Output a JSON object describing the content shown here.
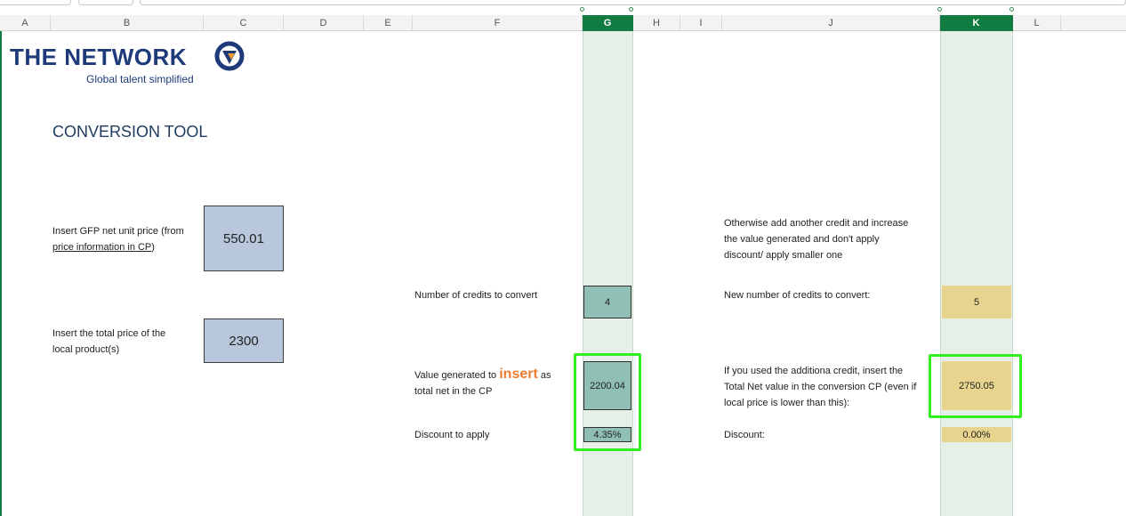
{
  "columns": [
    "A",
    "B",
    "C",
    "D",
    "E",
    "F",
    "G",
    "H",
    "I",
    "J",
    "K",
    "L"
  ],
  "selected_columns": [
    "G",
    "K"
  ],
  "logo": {
    "title": "THE NETWORK",
    "tagline": "Global talent simplified",
    "mark_icon": "network-globe-icon"
  },
  "title": "CONVERSION TOOL",
  "inputs": {
    "gfp_label_1": "Insert GFP net unit price (from",
    "gfp_label_2": "price information in CP",
    "gfp_label_3": ")",
    "gfp_value": "550.01",
    "local_label_1": "Insert the total price of the",
    "local_label_2": "local product(s)",
    "local_value": "2300"
  },
  "left_results": {
    "credits_label": "Number of credits to convert",
    "credits_value": "4",
    "value_label_1": "Value generated to",
    "value_label_insert": "insert",
    "value_label_2": "as",
    "value_label_3": "total net in the CP",
    "value_value": "2200.04",
    "discount_label": "Discount to apply",
    "discount_value": "4.35%"
  },
  "right_results": {
    "otherwise_1": "Otherwise add another credit and increase",
    "otherwise_2": "the value generated and don't apply",
    "otherwise_3": "discount/ apply smaller one",
    "new_credits_label": "New number of credits to convert:",
    "new_credits_value": "5",
    "additional_1": "If you used the additiona credit, insert the",
    "additional_2": "Total Net value in the conversion CP (even if",
    "additional_3": "local price is lower than this):",
    "additional_value": "2750.05",
    "discount_label": "Discount:",
    "discount_value": "0.00%"
  },
  "colors": {
    "excel_green": "#107c41",
    "highlight_green": "#33ee22",
    "input_blue": "#b8c7dc",
    "result_teal": "#8fbfb5",
    "result_tan": "#e8d48f",
    "logo_navy": "#1f3a7a",
    "logo_accent": "#f0a030",
    "insert_orange": "#ed7d31"
  }
}
